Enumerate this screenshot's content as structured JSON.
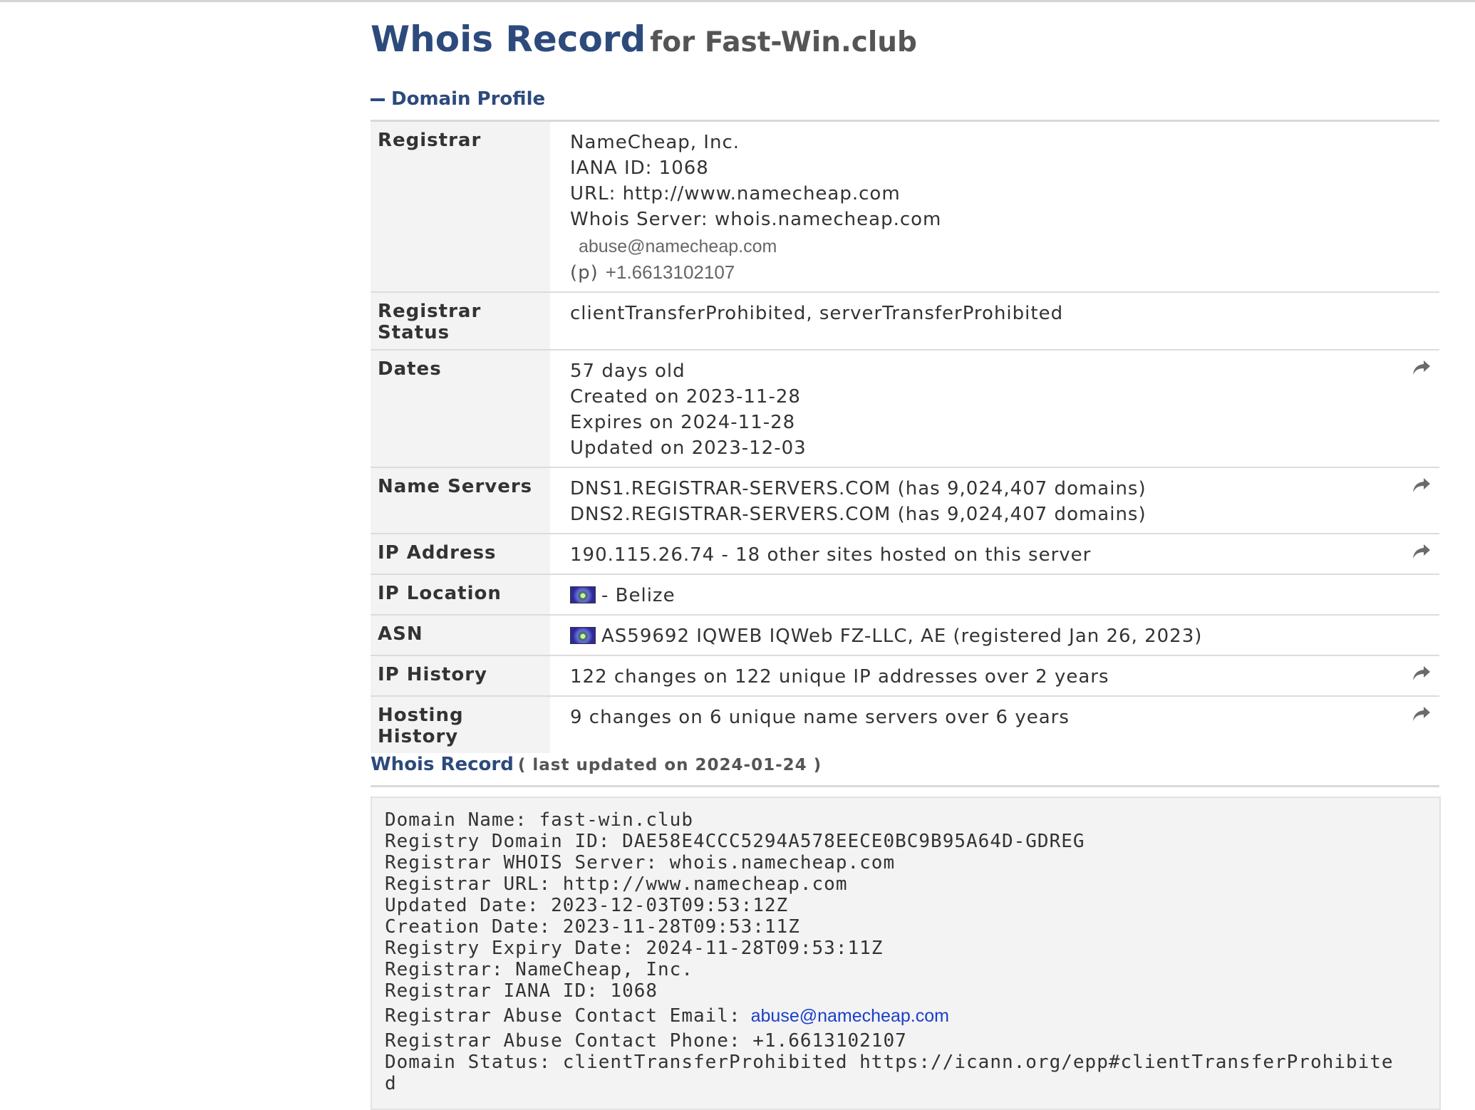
{
  "title": {
    "main": "Whois Record",
    "sub": "for Fast-Win.club"
  },
  "profile": {
    "heading": "Domain Profile",
    "rows": {
      "registrar": {
        "key": "Registrar",
        "name": "NameCheap, Inc.",
        "iana": "IANA ID: 1068",
        "url": "URL: http://www.namecheap.com",
        "whois_server": "Whois Server: whois.namecheap.com",
        "email": "abuse@namecheap.com",
        "phone_prefix": "(p)",
        "phone": "+1.6613102107"
      },
      "status": {
        "key": "Registrar Status",
        "value": "clientTransferProhibited, serverTransferProhibited"
      },
      "dates": {
        "key": "Dates",
        "age": "57 days old",
        "created": "Created on 2023-11-28",
        "expires": "Expires on 2024-11-28",
        "updated": "Updated on 2023-12-03"
      },
      "nameservers": {
        "key": "Name Servers",
        "ns1": "DNS1.REGISTRAR-SERVERS.COM (has 9,024,407 domains)",
        "ns2": "DNS2.REGISTRAR-SERVERS.COM (has 9,024,407 domains)"
      },
      "ip": {
        "key": "IP Address",
        "value": "190.115.26.74 - 18 other sites hosted on this server"
      },
      "location": {
        "key": "IP Location",
        "value": "- Belize"
      },
      "asn": {
        "key": "ASN",
        "value": "AS59692 IQWEB IQWeb FZ-LLC, AE (registered Jan 26, 2023)"
      },
      "ip_history": {
        "key": "IP History",
        "value": "122 changes on 122 unique IP addresses over 2 years"
      },
      "hosting_history": {
        "key": "Hosting History",
        "value": "9 changes on 6 unique name servers over 6 years"
      }
    }
  },
  "record": {
    "heading": "Whois Record",
    "updated": "( last updated on 2024-01-24 )",
    "lines": {
      "l1": "Domain Name: fast-win.club",
      "l2": "Registry Domain ID: DAE58E4CCC5294A578EECE0BC9B95A64D-GDREG",
      "l3": "Registrar WHOIS Server: whois.namecheap.com",
      "l4": "Registrar URL: http://www.namecheap.com",
      "l5": "Updated Date: 2023-12-03T09:53:12Z",
      "l6": "Creation Date: 2023-11-28T09:53:11Z",
      "l7": "Registry Expiry Date: 2024-11-28T09:53:11Z",
      "l8": "Registrar: NameCheap, Inc.",
      "l9": "Registrar IANA ID: 1068",
      "l10": "Registrar Abuse Contact Email:",
      "l10_link": "abuse@namecheap.com",
      "l11": "Registrar Abuse Contact Phone: +1.6613102107",
      "l12": "Domain Status: clientTransferProhibited https://icann.org/epp#clientTransferProhibite",
      "l13": "d"
    }
  },
  "colors": {
    "accent": "#2c4a7c",
    "link": "#1a3ec9"
  },
  "icons": {
    "share": "share-arrow-icon",
    "flag": "country-flag-icon",
    "collapse": "minus-icon"
  }
}
